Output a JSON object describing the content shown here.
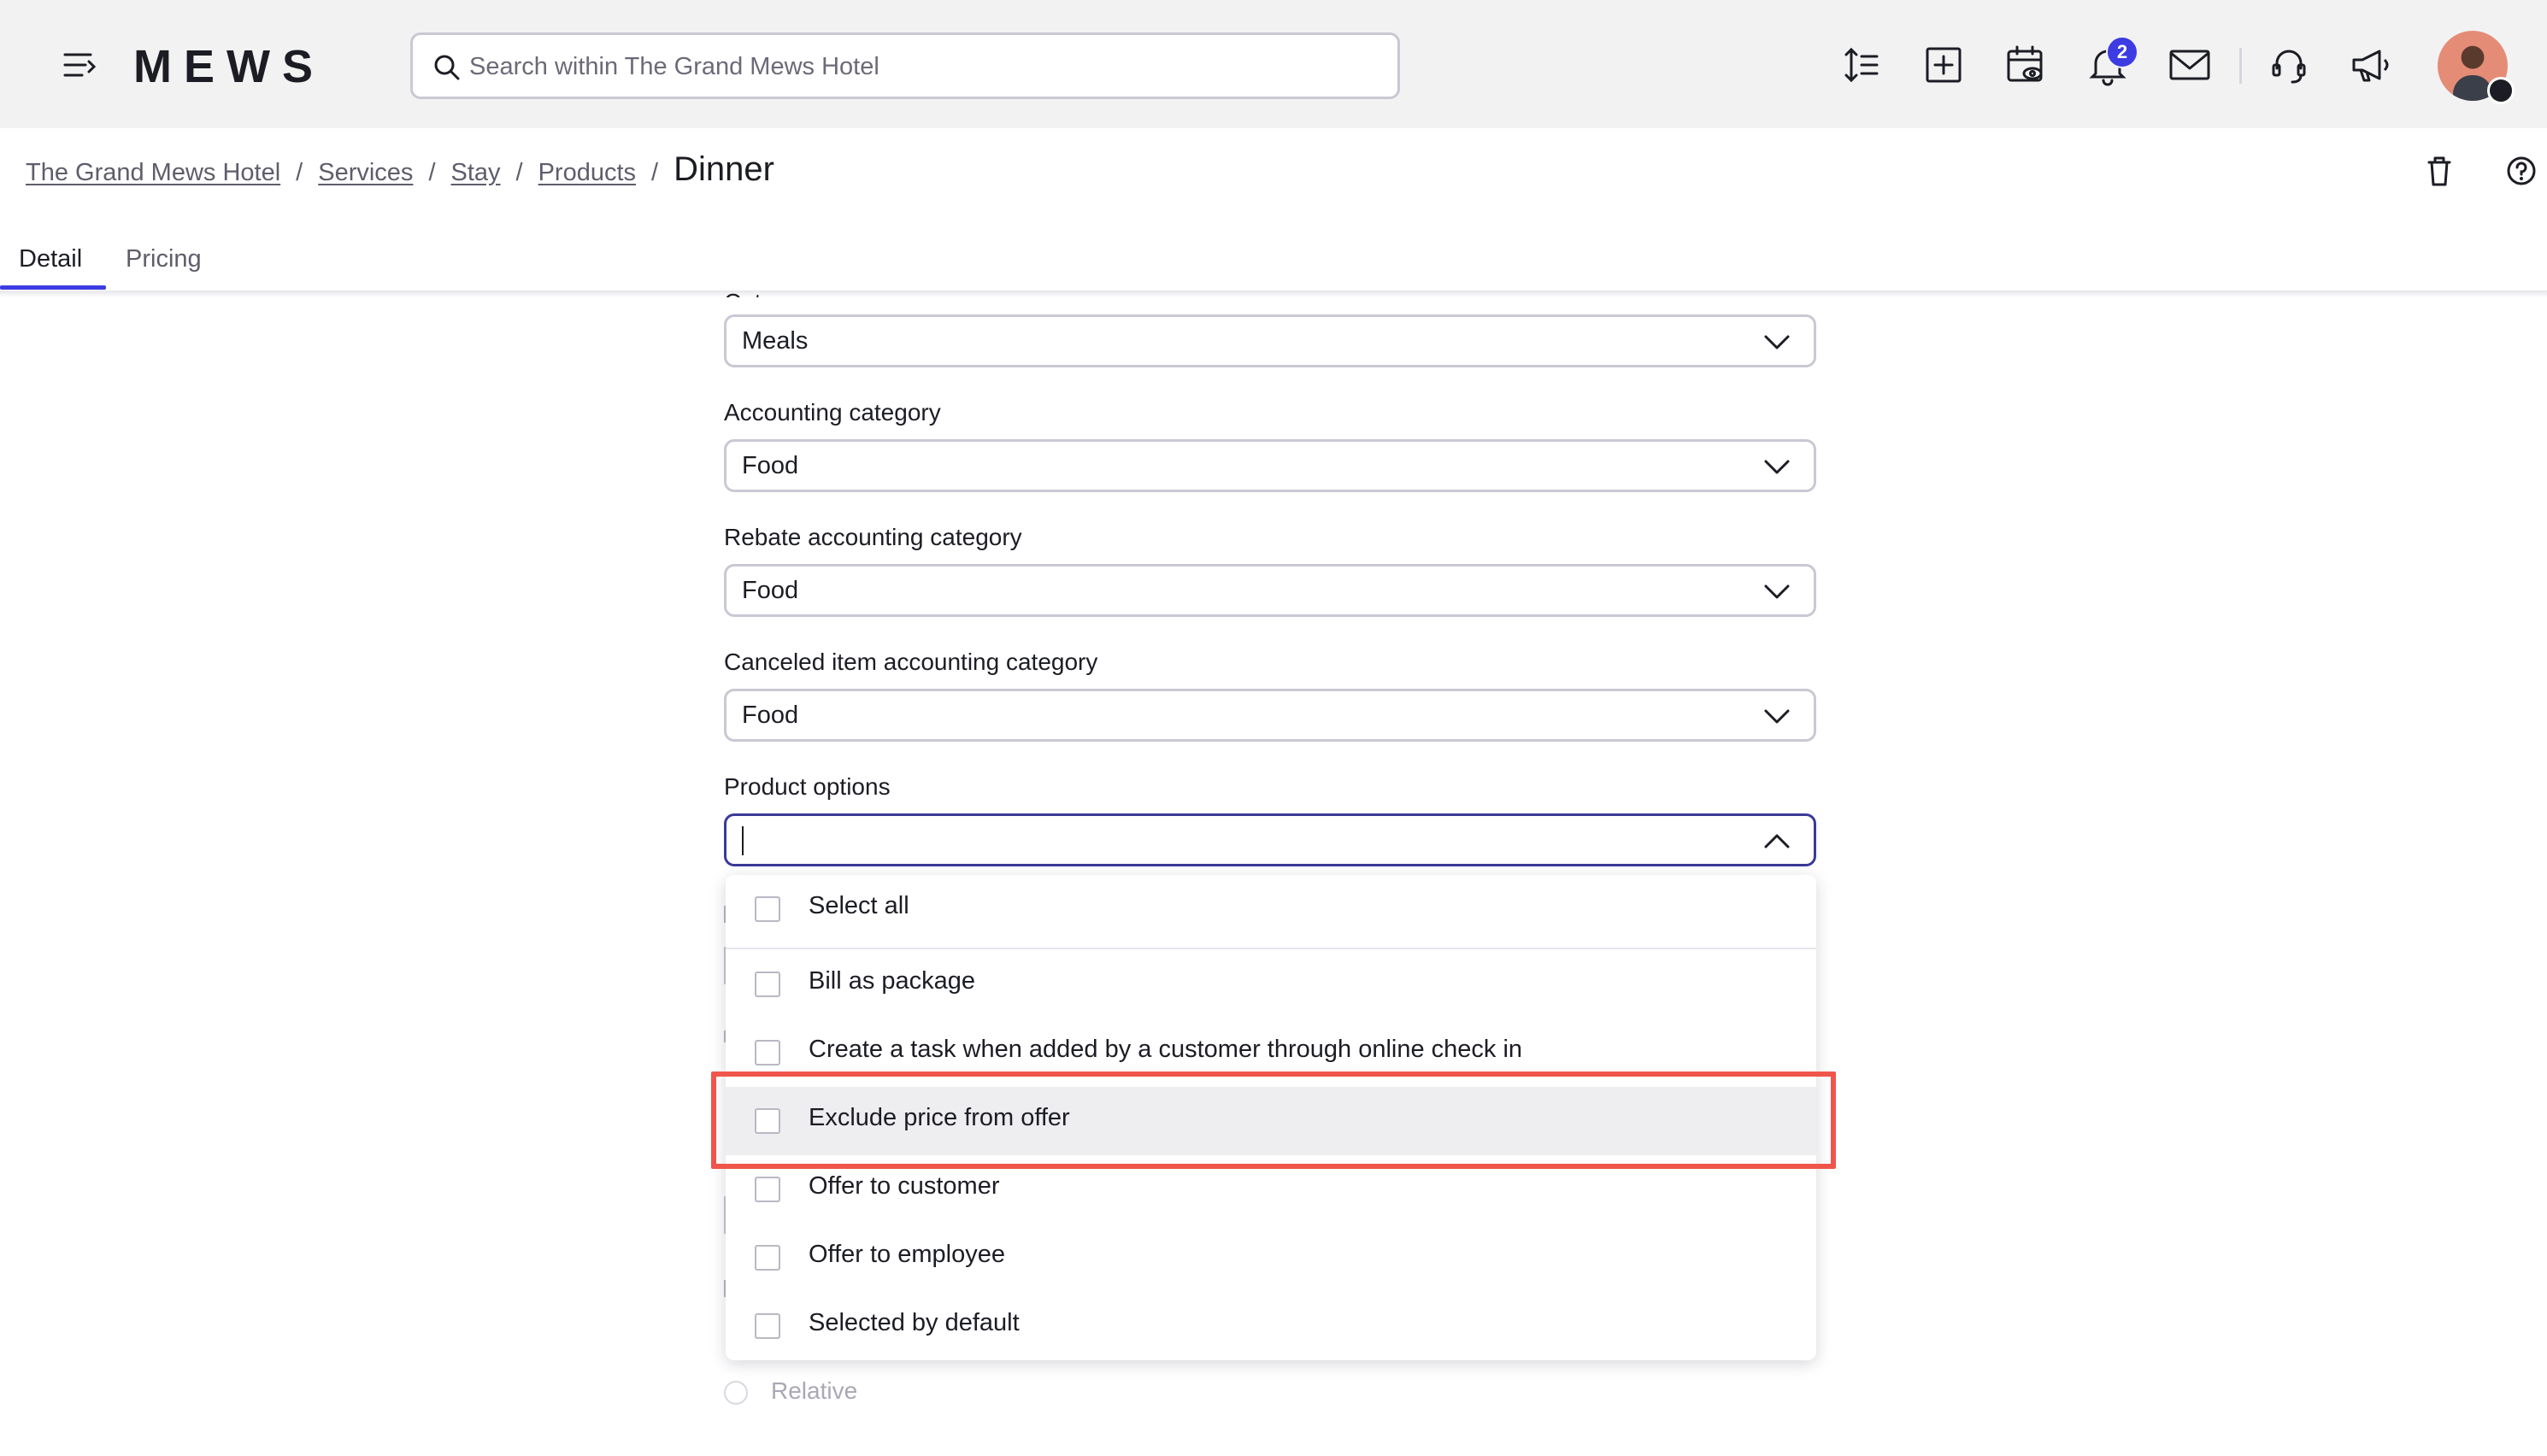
{
  "topbar": {
    "logo": "MEWS",
    "search_placeholder": "Search within The Grand Mews Hotel",
    "notification_count": "2",
    "icons": [
      "menu-icon",
      "search-icon",
      "sort-icon",
      "add-icon",
      "calendar-icon",
      "bell-icon",
      "mail-icon",
      "headset-icon",
      "megaphone-icon",
      "avatar"
    ]
  },
  "breadcrumb": {
    "items": [
      "The Grand Mews Hotel",
      "Services",
      "Stay",
      "Products"
    ],
    "separator": "/",
    "current": "Dinner"
  },
  "tabs": {
    "detail": "Detail",
    "pricing": "Pricing",
    "active": "Detail"
  },
  "form": {
    "category": {
      "label": "Category",
      "value": "Meals"
    },
    "accounting_category": {
      "label": "Accounting category",
      "value": "Food"
    },
    "rebate_accounting_category": {
      "label": "Rebate accounting category",
      "value": "Food"
    },
    "canceled_item_accounting_category": {
      "label": "Canceled item accounting category",
      "value": "Food"
    },
    "product_options": {
      "label": "Product options",
      "value": ""
    },
    "relative_label": "Relative"
  },
  "dropdown": {
    "items": [
      {
        "label": "Select all",
        "checked": false
      },
      {
        "label": "Bill as package",
        "checked": false
      },
      {
        "label": "Create a task when added by a customer through online check in",
        "checked": false
      },
      {
        "label": "Exclude price from offer",
        "checked": false,
        "highlighted": true
      },
      {
        "label": "Offer to customer",
        "checked": false
      },
      {
        "label": "Offer to employee",
        "checked": false
      },
      {
        "label": "Selected by default",
        "checked": false
      }
    ]
  },
  "colors": {
    "accent": "#3d3ce2",
    "highlight_border": "#f0554b",
    "topbar_bg": "#f2f2f3"
  }
}
